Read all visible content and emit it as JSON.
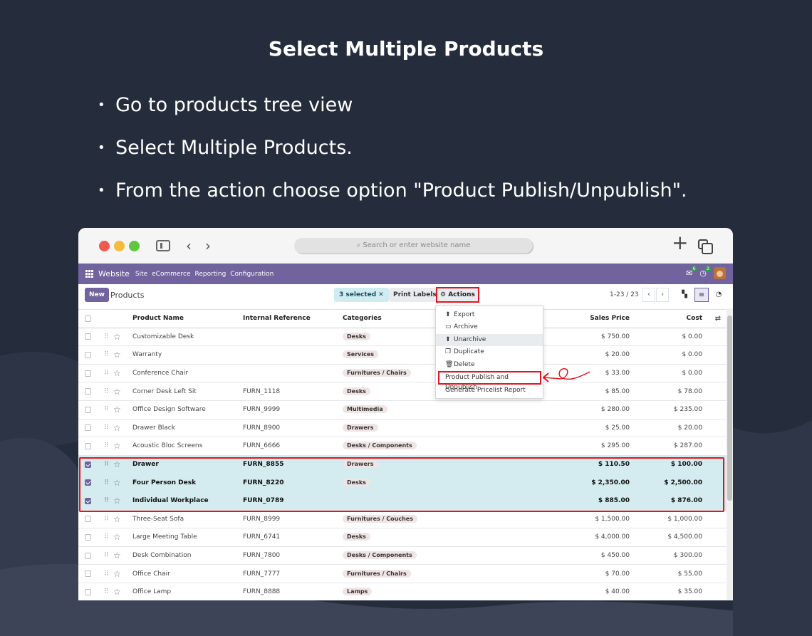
{
  "headline": "Select Multiple Products",
  "bullets": [
    "Go to products tree view",
    "Select Multiple Products.",
    "From the action choose option \"Product Publish/Unpublish\"."
  ],
  "browser": {
    "url_placeholder": "Search or enter website name"
  },
  "navbar": {
    "brand": "Website",
    "items": [
      "Site",
      "eCommerce",
      "Reporting",
      "Configuration"
    ],
    "messages_count": "6",
    "activities_count": "2"
  },
  "control": {
    "new_label": "New",
    "title": "Products",
    "selected_label": "3 selected",
    "print_label": "Print Labels",
    "actions_label": "Actions",
    "pager": "1-23 / 23"
  },
  "table": {
    "headers": {
      "name": "Product Name",
      "ref": "Internal Reference",
      "category": "Categories",
      "price": "Sales Price",
      "cost": "Cost"
    },
    "rows": [
      {
        "name": "Customizable Desk",
        "ref": "",
        "category": "Desks",
        "price": "$ 750.00",
        "cost": "$ 0.00",
        "selected": false
      },
      {
        "name": "Warranty",
        "ref": "",
        "category": "Services",
        "price": "$ 20.00",
        "cost": "$ 0.00",
        "selected": false
      },
      {
        "name": "Conference Chair",
        "ref": "",
        "category": "Furnitures / Chairs",
        "price": "$ 33.00",
        "cost": "$ 0.00",
        "selected": false
      },
      {
        "name": "Corner Desk Left Sit",
        "ref": "FURN_1118",
        "category": "Desks",
        "price": "$ 85.00",
        "cost": "$ 78.00",
        "selected": false
      },
      {
        "name": "Office Design Software",
        "ref": "FURN_9999",
        "category": "Multimedia",
        "price": "$ 280.00",
        "cost": "$ 235.00",
        "selected": false
      },
      {
        "name": "Drawer Black",
        "ref": "FURN_8900",
        "category": "Drawers",
        "price": "$ 25.00",
        "cost": "$ 20.00",
        "selected": false
      },
      {
        "name": "Acoustic Bloc Screens",
        "ref": "FURN_6666",
        "category": "Desks / Components",
        "price": "$ 295.00",
        "cost": "$ 287.00",
        "selected": false
      },
      {
        "name": "Drawer",
        "ref": "FURN_8855",
        "category": "Drawers",
        "price": "$ 110.50",
        "cost": "$ 100.00",
        "selected": true
      },
      {
        "name": "Four Person Desk",
        "ref": "FURN_8220",
        "category": "Desks",
        "price": "$ 2,350.00",
        "cost": "$ 2,500.00",
        "selected": true
      },
      {
        "name": "Individual Workplace",
        "ref": "FURN_0789",
        "category": "",
        "price": "$ 885.00",
        "cost": "$ 876.00",
        "selected": true
      },
      {
        "name": "Three-Seat Sofa",
        "ref": "FURN_8999",
        "category": "Furnitures / Couches",
        "price": "$ 1,500.00",
        "cost": "$ 1,000.00",
        "selected": false
      },
      {
        "name": "Large Meeting Table",
        "ref": "FURN_6741",
        "category": "Desks",
        "price": "$ 4,000.00",
        "cost": "$ 4,500.00",
        "selected": false
      },
      {
        "name": "Desk Combination",
        "ref": "FURN_7800",
        "category": "Desks / Components",
        "price": "$ 450.00",
        "cost": "$ 300.00",
        "selected": false
      },
      {
        "name": "Office Chair",
        "ref": "FURN_7777",
        "category": "Furnitures / Chairs",
        "price": "$ 70.00",
        "cost": "$ 55.00",
        "selected": false
      },
      {
        "name": "Office Lamp",
        "ref": "FURN_8888",
        "category": "Lamps",
        "price": "$ 40.00",
        "cost": "$ 35.00",
        "selected": false
      }
    ]
  },
  "actions_menu": [
    {
      "label": "Export",
      "icon": "upload-icon"
    },
    {
      "label": "Archive",
      "icon": "archive-icon"
    },
    {
      "label": "Unarchive",
      "icon": "unarchive-icon"
    },
    {
      "label": "Duplicate",
      "icon": "copy-icon"
    },
    {
      "label": "Delete",
      "icon": "trash-icon"
    },
    {
      "label": "Product Publish and Unpublish",
      "icon": ""
    },
    {
      "label": "Generate Pricelist Report",
      "icon": ""
    }
  ],
  "colors": {
    "background": "#252c3b",
    "odoo_primary": "#71639e",
    "highlight_red": "#e0161d",
    "selected_row": "#d4ecef"
  }
}
